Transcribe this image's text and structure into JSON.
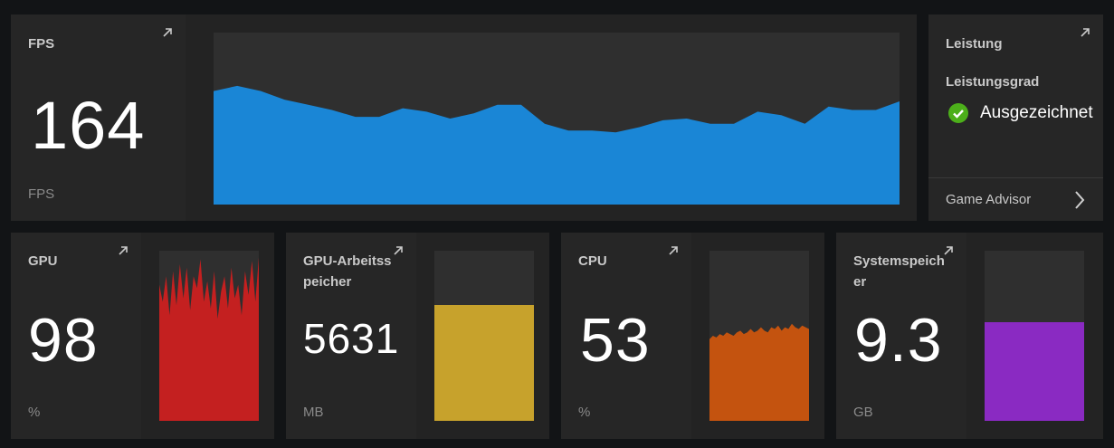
{
  "fps": {
    "title": "FPS",
    "value": "164",
    "unit": "FPS",
    "color": "#1a86d6",
    "history": [
      0.66,
      0.69,
      0.66,
      0.61,
      0.58,
      0.55,
      0.51,
      0.51,
      0.56,
      0.54,
      0.5,
      0.53,
      0.58,
      0.58,
      0.47,
      0.43,
      0.43,
      0.42,
      0.45,
      0.49,
      0.5,
      0.47,
      0.47,
      0.54,
      0.52,
      0.47,
      0.57,
      0.55,
      0.55,
      0.6
    ]
  },
  "performance": {
    "title": "Leistung",
    "grade_label": "Leistungsgrad",
    "grade_value": "Ausgezeichnet",
    "status_color": "#4caf1a",
    "advisor_label": "Game Advisor"
  },
  "gpu": {
    "title": "GPU",
    "value": "98",
    "unit": "%",
    "color": "#c42020",
    "history": [
      0.8,
      0.7,
      0.85,
      0.62,
      0.88,
      0.68,
      0.92,
      0.72,
      0.9,
      0.65,
      0.85,
      0.78,
      0.95,
      0.7,
      0.82,
      0.66,
      0.88,
      0.6,
      0.76,
      0.85,
      0.66,
      0.9,
      0.72,
      0.8,
      0.62,
      0.88,
      0.74,
      0.94,
      0.7,
      0.96
    ]
  },
  "gpu_mem": {
    "title": "GPU-Arbeitsspeicher",
    "value": "5631",
    "unit": "MB",
    "color": "#c7a22c",
    "level": 0.68
  },
  "cpu": {
    "title": "CPU",
    "value": "53",
    "unit": "%",
    "color": "#c4530f",
    "history": [
      0.48,
      0.5,
      0.49,
      0.51,
      0.5,
      0.52,
      0.51,
      0.5,
      0.52,
      0.53,
      0.51,
      0.52,
      0.54,
      0.52,
      0.53,
      0.55,
      0.53,
      0.52,
      0.55,
      0.54,
      0.56,
      0.53,
      0.55,
      0.54,
      0.57,
      0.55,
      0.54,
      0.56,
      0.55,
      0.54
    ]
  },
  "sys_mem": {
    "title": "Systemspeicher",
    "value": "9.3",
    "unit": "GB",
    "color": "#8a2ac2",
    "level": 0.58
  }
}
